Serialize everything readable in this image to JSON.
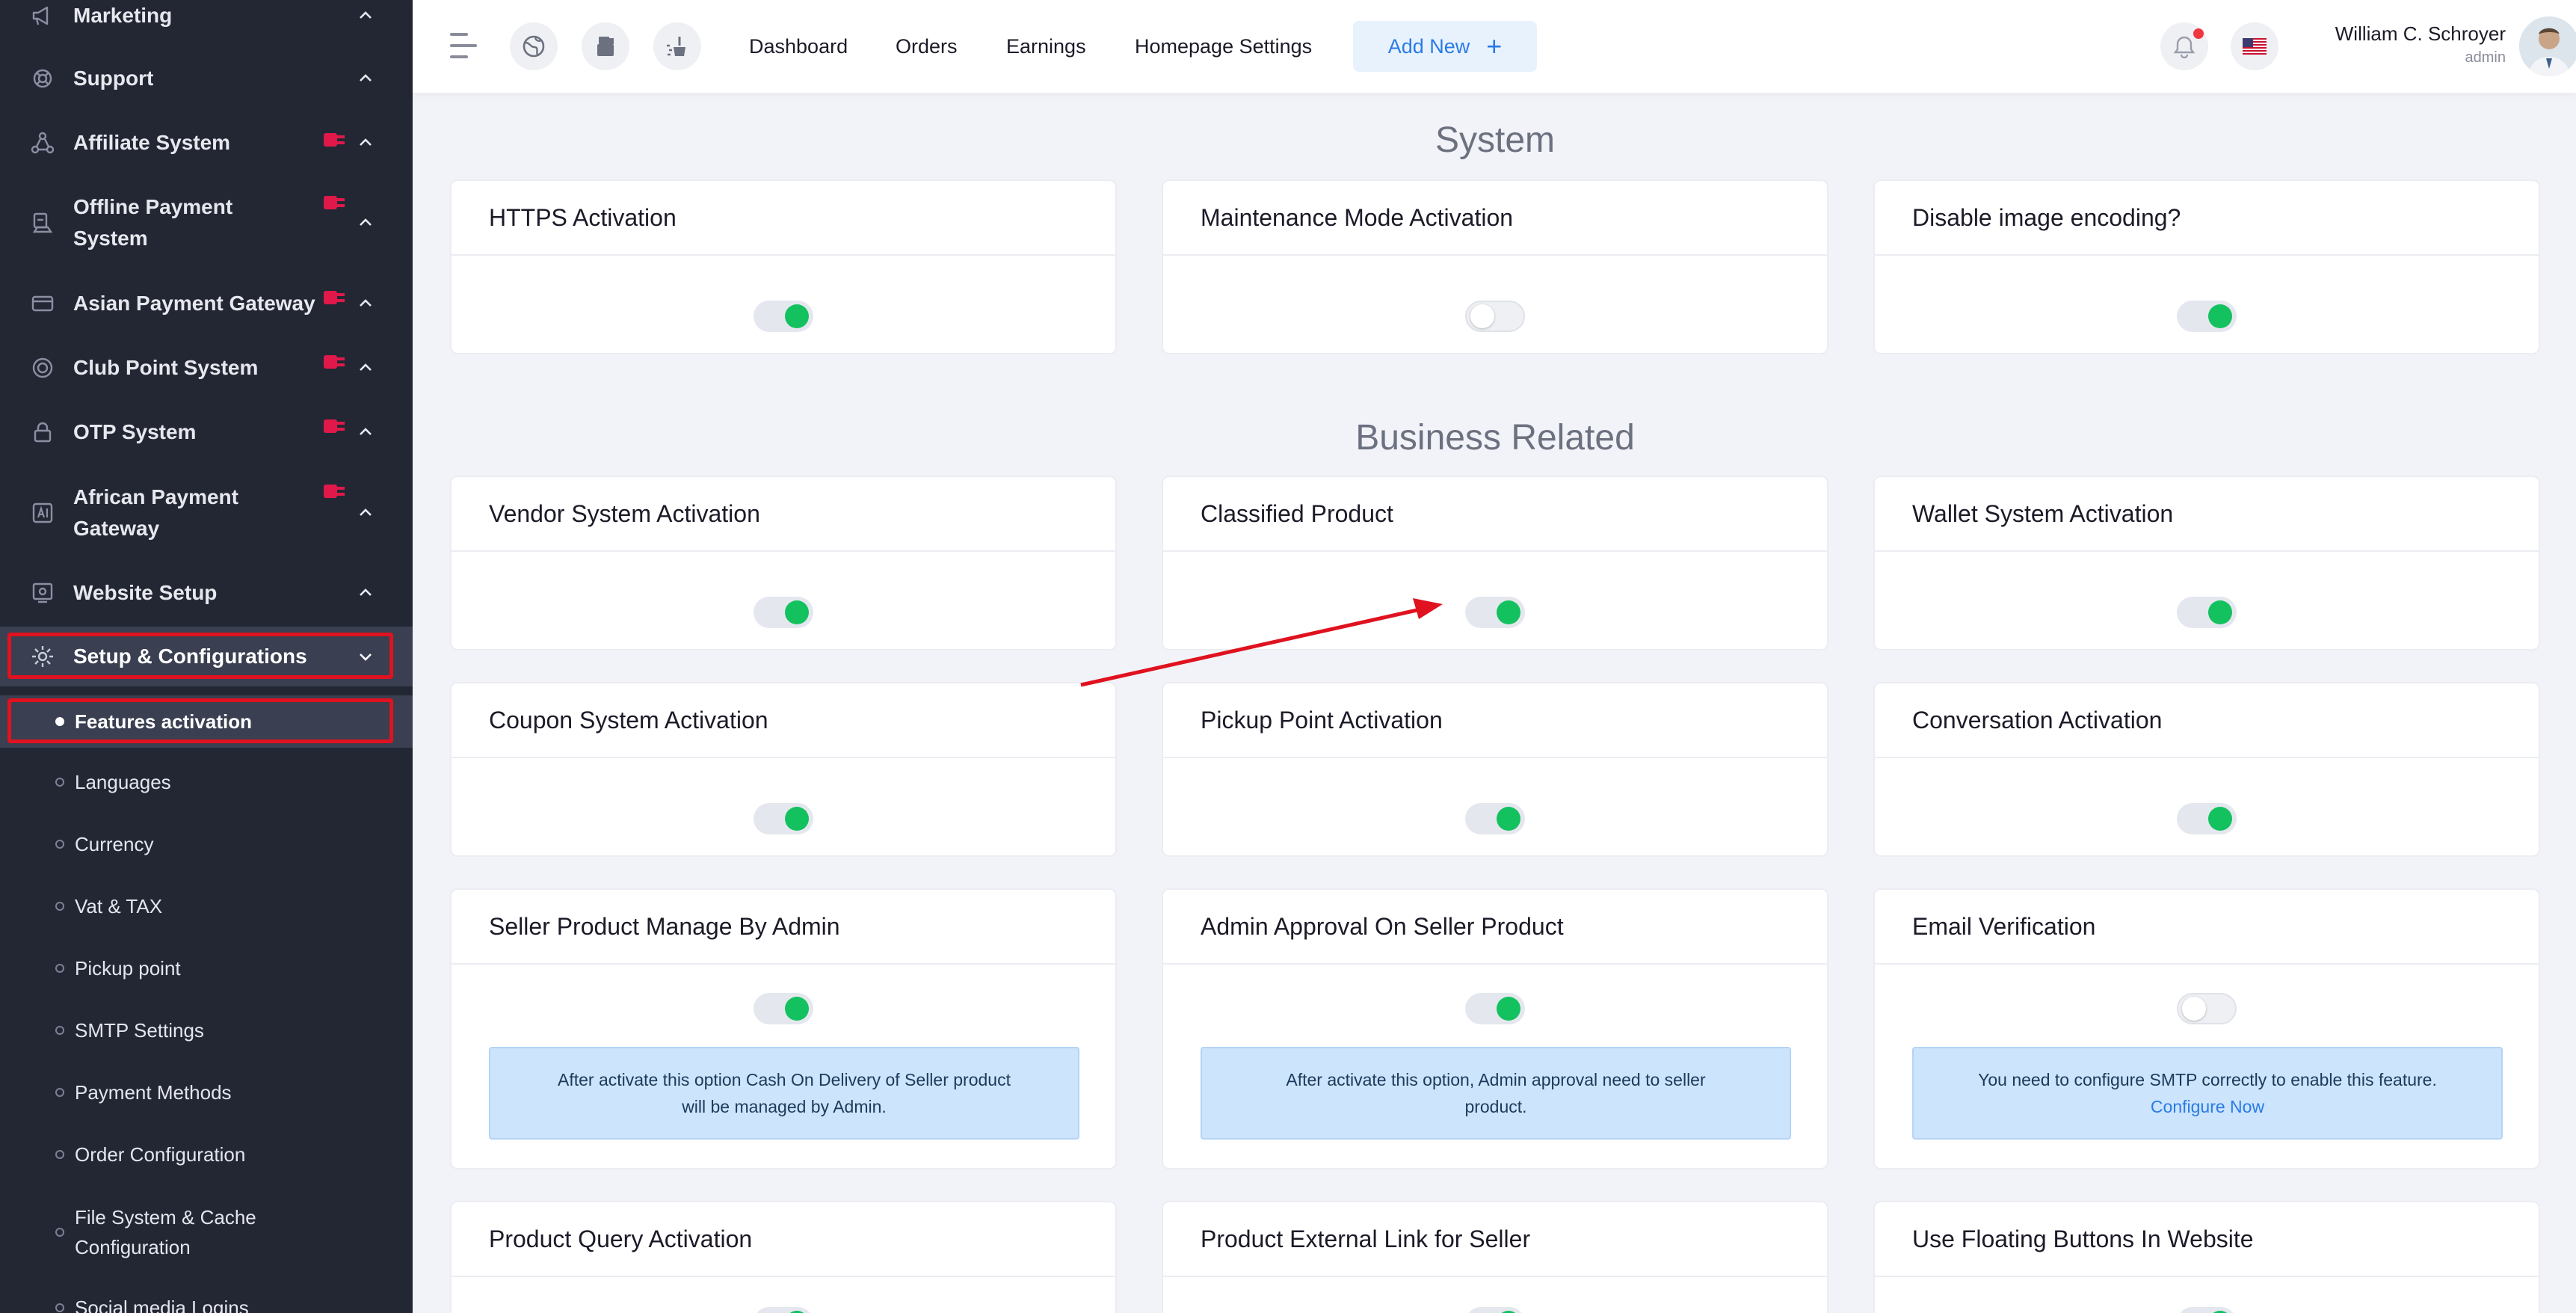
{
  "sidebar": {
    "items": [
      {
        "label": "Marketing",
        "icon": "megaphone-icon",
        "addon": false
      },
      {
        "label": "Support",
        "icon": "support-icon",
        "addon": false
      },
      {
        "label": "Affiliate System",
        "icon": "affiliate-icon",
        "addon": true
      },
      {
        "label": "Offline Payment",
        "label2": "System",
        "icon": "offline-payment-icon",
        "addon": true
      },
      {
        "label": "Asian Payment Gateway",
        "icon": "payment-card-icon",
        "addon": true
      },
      {
        "label": "Club Point System",
        "icon": "club-point-icon",
        "addon": true
      },
      {
        "label": "OTP System",
        "icon": "otp-icon",
        "addon": true
      },
      {
        "label": "African Payment",
        "label2": "Gateway",
        "icon": "african-payment-icon",
        "addon": true
      },
      {
        "label": "Website Setup",
        "icon": "website-setup-icon",
        "addon": false
      },
      {
        "label": "Setup & Configurations",
        "icon": "setup-gear-icon",
        "addon": false
      }
    ],
    "subitems": [
      {
        "label": "Features activation",
        "active": true
      },
      {
        "label": "Languages"
      },
      {
        "label": "Currency"
      },
      {
        "label": "Vat & TAX"
      },
      {
        "label": "Pickup point"
      },
      {
        "label": "SMTP Settings"
      },
      {
        "label": "Payment Methods"
      },
      {
        "label": "Order Configuration"
      },
      {
        "label": "File System & Cache",
        "label2": "Configuration"
      },
      {
        "label": "Social media Logins"
      }
    ]
  },
  "header": {
    "nav": [
      "Dashboard",
      "Orders",
      "Earnings",
      "Homepage Settings"
    ],
    "add_new": "Add New",
    "user_name": "William C. Schroyer",
    "user_role": "admin",
    "icons": [
      "globe-icon",
      "pos-icon",
      "clear-cache-icon",
      "bell-icon",
      "us-flag-icon"
    ]
  },
  "sections": {
    "system": "System",
    "business": "Business Related"
  },
  "cards": {
    "https": {
      "title": "HTTPS Activation",
      "on": true
    },
    "maintenance": {
      "title": "Maintenance Mode Activation",
      "on": false
    },
    "image_encoding": {
      "title": "Disable image encoding?",
      "on": true
    },
    "vendor": {
      "title": "Vendor System Activation",
      "on": true
    },
    "classified": {
      "title": "Classified Product",
      "on": true
    },
    "wallet": {
      "title": "Wallet System Activation",
      "on": true
    },
    "coupon": {
      "title": "Coupon System Activation",
      "on": true
    },
    "pickup": {
      "title": "Pickup Point Activation",
      "on": true
    },
    "conversation": {
      "title": "Conversation Activation",
      "on": true
    },
    "seller_manage": {
      "title": "Seller Product Manage By Admin",
      "on": true,
      "note1": "After activate this option Cash On Delivery of Seller product",
      "note2": "will be managed by Admin."
    },
    "admin_approval": {
      "title": "Admin Approval On Seller Product",
      "on": true,
      "note1": "After activate this option, Admin approval need to seller",
      "note2": "product."
    },
    "email_verify": {
      "title": "Email Verification",
      "on": false,
      "note1": "You need to configure SMTP correctly to enable this feature.",
      "link": "Configure Now"
    },
    "product_query": {
      "title": "Product Query Activation",
      "on": true
    },
    "external_link": {
      "title": "Product External Link for Seller",
      "on": true
    },
    "floating_buttons": {
      "title": "Use Floating Buttons In Website",
      "on": true
    }
  },
  "colors": {
    "sidebar_bg": "#232734",
    "accent": "#2a7be4",
    "toggle_on": "#14c15f",
    "highlight": "#e0121f"
  }
}
